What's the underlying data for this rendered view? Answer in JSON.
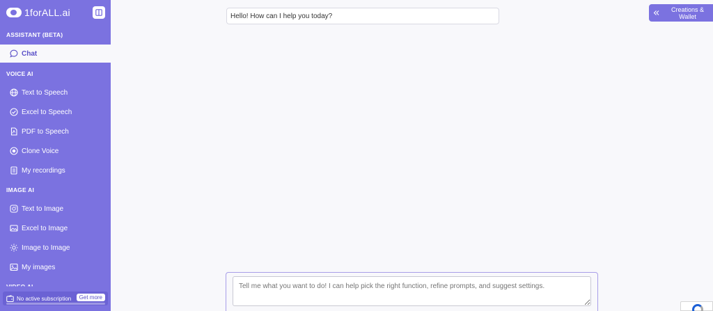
{
  "brand": {
    "name": "1forALL.ai"
  },
  "sidebar": {
    "sections": [
      {
        "title": "ASSISTANT (BETA)"
      },
      {
        "title": "VOICE AI"
      },
      {
        "title": "IMAGE AI"
      },
      {
        "title": "VIDEO AI"
      }
    ],
    "items": [
      {
        "label": "Chat",
        "icon": "chat-icon"
      },
      {
        "label": "Text to Speech",
        "icon": "globe-icon"
      },
      {
        "label": "Excel to Speech",
        "icon": "check-circle-icon"
      },
      {
        "label": "PDF to Speech",
        "icon": "pdf-file-icon"
      },
      {
        "label": "Clone Voice",
        "icon": "record-icon"
      },
      {
        "label": "My recordings",
        "icon": "document-list-icon"
      },
      {
        "label": "Text to Image",
        "icon": "image-frame-icon"
      },
      {
        "label": "Excel to Image",
        "icon": "gallery-icon"
      },
      {
        "label": "Image to Image",
        "icon": "sun-icon"
      },
      {
        "label": "My images",
        "icon": "picture-icon"
      }
    ],
    "subscription": {
      "text": "No active subscription",
      "cta": "Get more"
    }
  },
  "main": {
    "greeting": "Hello! How can I help you today?",
    "creations_button": "Creations & Wallet",
    "composer_placeholder": "Tell me what you want to do! I can help pick the right function, refine prompts, and suggest settings."
  },
  "colors": {
    "accent": "#7b72e0",
    "active_text": "#5a50c8",
    "background": "#f8f8fb"
  }
}
